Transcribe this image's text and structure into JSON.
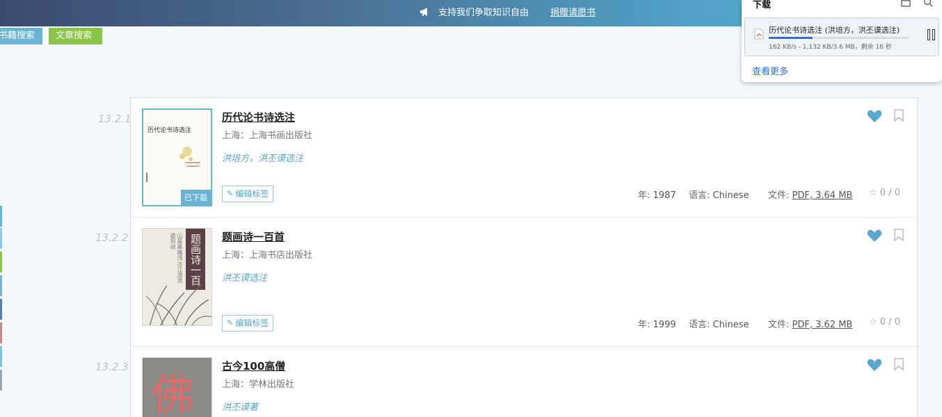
{
  "banner": {
    "message": "支持我们争取知识自由",
    "link": "捐赠请愿书",
    "icon": "megaphone-icon"
  },
  "search_tabs": {
    "books": "书籍搜索",
    "articles": "文章搜索"
  },
  "download_panel": {
    "title": "下载",
    "item": {
      "name": "历代论书诗选注 (洪培方，洪丕谟选注)",
      "status": "162 KB/s - 1,132 KB/3.6 MB，剩余 16 秒",
      "progress_percent": 31
    },
    "see_more": "查看更多"
  },
  "colors": {
    "accent": "#6bb3d4",
    "article_tab": "#8bc34a",
    "link_blue": "#2d6fd3"
  },
  "results": [
    {
      "number": "13.2.1",
      "title": "历代论书诗选注",
      "publisher": "上海：上海书画出版社",
      "authors": "洪培方，洪丕谟选注",
      "edit_label": "编辑标签",
      "downloaded_badge": "已下载",
      "cover_title": "历代论书诗选注",
      "year_label": "年:",
      "year": "1987",
      "language_label": "语言:",
      "language": "Chinese",
      "file_label": "文件:",
      "file": "PDF, 3.64 MB",
      "rating": "0 / 0"
    },
    {
      "number": "13.2.2",
      "title": "题画诗一百首",
      "publisher": "上海：上海书店出版社",
      "authors": "洪丕谟选注",
      "edit_label": "编辑标签",
      "cover_title": "题画诗一百首",
      "year_label": "年:",
      "year": "1999",
      "language_label": "语言:",
      "language": "Chinese",
      "file_label": "文件:",
      "file": "PDF, 3.62 MB",
      "rating": "0 / 0"
    },
    {
      "number": "13.2.3",
      "title": "古今100高僧",
      "publisher": "上海：学林出版社",
      "authors": "洪丕谟著",
      "cover_title": "佛"
    }
  ]
}
